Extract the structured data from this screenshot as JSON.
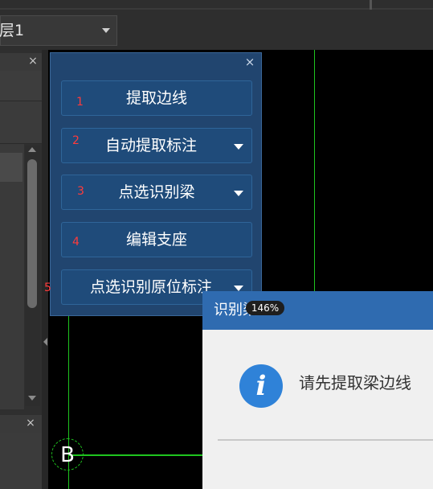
{
  "toolbar": {
    "floor_select_value": "层1"
  },
  "left_panel": {
    "close_glyph": "×",
    "close_glyph_2": "×"
  },
  "tool_panel": {
    "close_glyph": "×",
    "buttons": [
      {
        "number": "1",
        "label": "提取边线",
        "has_dropdown": false
      },
      {
        "number": "2",
        "label": "自动提取标注",
        "has_dropdown": true
      },
      {
        "number": "3",
        "label": "点选识别梁",
        "has_dropdown": true
      },
      {
        "number": "4",
        "label": "编辑支座",
        "has_dropdown": false
      },
      {
        "number": "5",
        "label": "点选识别原位标注",
        "has_dropdown": true
      }
    ]
  },
  "canvas": {
    "axis_label": "B",
    "grid_color": "#1fc41f"
  },
  "dialog": {
    "title": "识别梁",
    "zoom_badge": "146%",
    "message": "请先提取梁边线",
    "icon": "info-icon",
    "title_bar_color": "#2f6bb0"
  }
}
